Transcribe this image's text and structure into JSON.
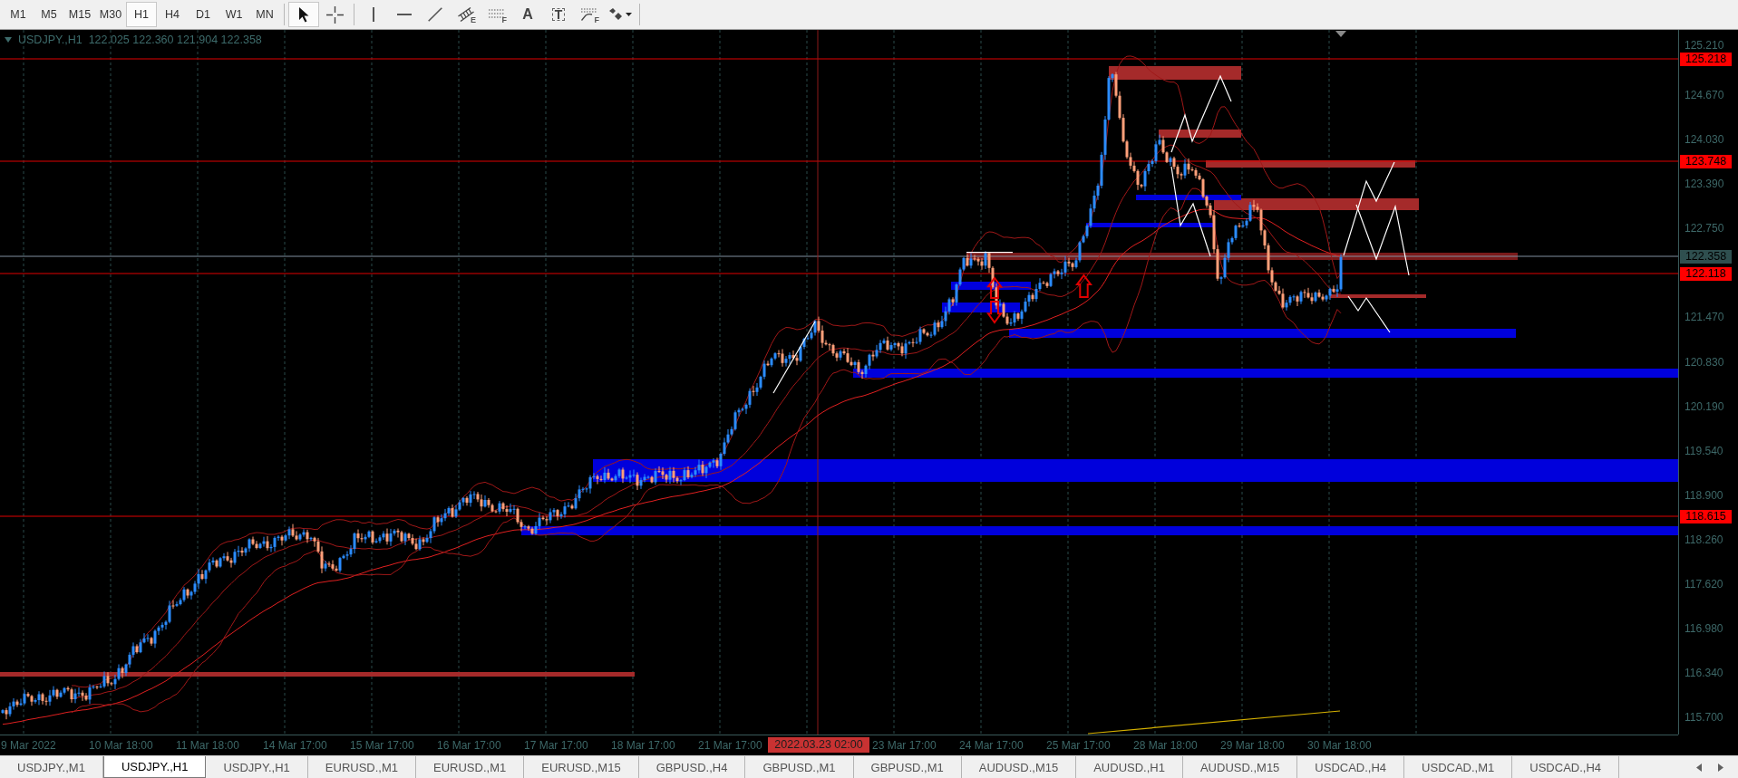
{
  "toolbar": {
    "periods": [
      {
        "label": "M1",
        "selected": false
      },
      {
        "label": "M5",
        "selected": false
      },
      {
        "label": "M15",
        "selected": false
      },
      {
        "label": "M30",
        "selected": false
      },
      {
        "label": "H1",
        "selected": true
      },
      {
        "label": "H4",
        "selected": false
      },
      {
        "label": "D1",
        "selected": false
      },
      {
        "label": "W1",
        "selected": false
      },
      {
        "label": "MN",
        "selected": false
      }
    ],
    "tools": [
      {
        "kind": "cursor",
        "selected": true
      },
      {
        "kind": "crosshair",
        "selected": false
      },
      {
        "kind": "vline",
        "selected": false
      },
      {
        "kind": "hline",
        "selected": false
      },
      {
        "kind": "trendline",
        "selected": false
      },
      {
        "kind": "channel",
        "letter": "E",
        "selected": false
      },
      {
        "kind": "fibo",
        "letter": "F",
        "selected": false
      },
      {
        "kind": "text",
        "label": "A",
        "selected": false
      },
      {
        "kind": "label",
        "label": "T",
        "selected": false
      },
      {
        "kind": "fan",
        "letter": "F",
        "selected": false
      },
      {
        "kind": "shapes",
        "selected": false
      }
    ]
  },
  "chart": {
    "symbol": "USDJPY.,H1",
    "ohlc": "122.025 122.360 121.904 122.358",
    "price_axis": [
      "125.210",
      "124.670",
      "124.030",
      "123.390",
      "122.750",
      "121.470",
      "120.830",
      "120.190",
      "119.540",
      "118.900",
      "118.260",
      "117.620",
      "116.980",
      "116.340",
      "115.700"
    ],
    "price_tags": [
      {
        "label": "125.218",
        "kind": "level"
      },
      {
        "label": "123.748",
        "kind": "level"
      },
      {
        "label": "122.358",
        "kind": "bid"
      },
      {
        "label": "122.118",
        "kind": "level"
      },
      {
        "label": "118.615",
        "kind": "level"
      }
    ],
    "time_axis": [
      "9 Mar 2022",
      "10 Mar 18:00",
      "11 Mar 18:00",
      "14 Mar 17:00",
      "15 Mar 17:00",
      "16 Mar 17:00",
      "17 Mar 17:00",
      "18 Mar 17:00",
      "21 Mar 17:00",
      "23 Mar 17:00",
      "24 Mar 17:00",
      "25 Mar 17:00",
      "28 Mar 18:00",
      "29 Mar 18:00",
      "30 Mar 18:00"
    ],
    "crosshair_time": "2022.03.23 02:00"
  },
  "tabs": [
    {
      "label": "USDJPY.,M1",
      "selected": false
    },
    {
      "label": "USDJPY.,H1",
      "selected": true
    },
    {
      "label": "USDJPY.,H1",
      "selected": false
    },
    {
      "label": "EURUSD.,M1",
      "selected": false
    },
    {
      "label": "EURUSD.,M1",
      "selected": false
    },
    {
      "label": "EURUSD.,M15",
      "selected": false
    },
    {
      "label": "GBPUSD.,H4",
      "selected": false
    },
    {
      "label": "GBPUSD.,M1",
      "selected": false
    },
    {
      "label": "GBPUSD.,M1",
      "selected": false
    },
    {
      "label": "AUDUSD.,M15",
      "selected": false
    },
    {
      "label": "AUDUSD.,H1",
      "selected": false
    },
    {
      "label": "AUDUSD.,M15",
      "selected": false
    },
    {
      "label": "USDCAD.,H4",
      "selected": false
    },
    {
      "label": "USDCAD.,M1",
      "selected": false
    },
    {
      "label": "USDCAD.,H4",
      "selected": false
    }
  ]
}
